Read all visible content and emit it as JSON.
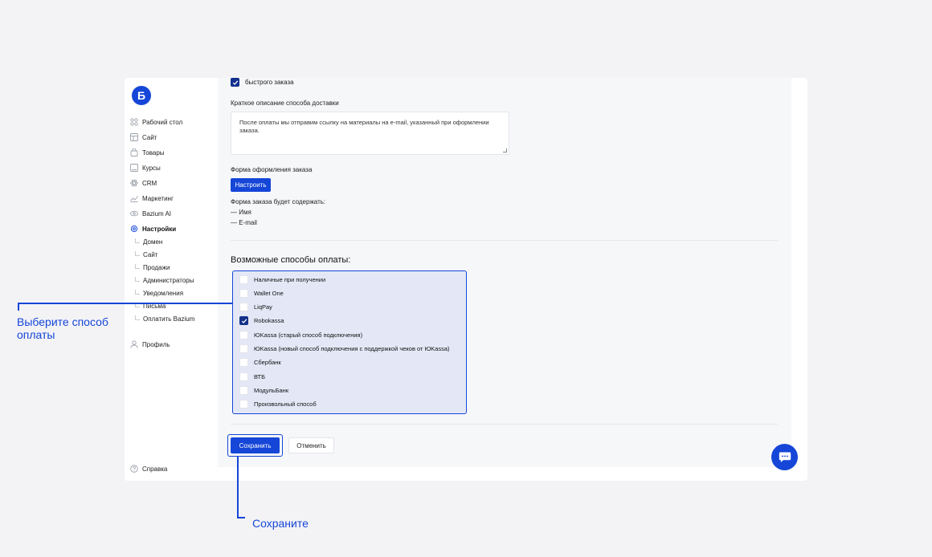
{
  "logo": {
    "letter": "Б"
  },
  "sidebar": {
    "items": [
      {
        "label": "Рабочий стол",
        "icon": "grid-icon"
      },
      {
        "label": "Сайт",
        "icon": "layout-icon"
      },
      {
        "label": "Товары",
        "icon": "bag-icon"
      },
      {
        "label": "Курсы",
        "icon": "book-icon"
      },
      {
        "label": "CRM",
        "icon": "atom-icon"
      },
      {
        "label": "Маркетинг",
        "icon": "chart-icon"
      },
      {
        "label": "Bazium AI",
        "icon": "ai-icon"
      },
      {
        "label": "Настройки",
        "icon": "gear-icon"
      }
    ],
    "sub_items": [
      "Домен",
      "Сайт",
      "Продажи",
      "Администраторы",
      "Уведомления",
      "Письма",
      "Оплатить Bazium"
    ],
    "profile": "Профиль",
    "help": "Справка"
  },
  "form": {
    "quick_order_label": "быстрого заказа",
    "quick_order_checked": true,
    "description_label": "Краткое описание способа доставки",
    "description_value": "После оплаты мы отправим ссылку на материалы на e-mail, указанный при оформлении заказа.",
    "order_form_label": "Форма оформления заказа",
    "configure_button": "Настроить",
    "order_form_contents_title": "Форма заказа будет содержать:",
    "order_form_fields": [
      "— Имя",
      "— E-mail"
    ],
    "payment_title": "Возможные способы оплаты:",
    "payment_methods": [
      {
        "label": "Наличные при получении",
        "checked": false
      },
      {
        "label": "Wallet One",
        "checked": false
      },
      {
        "label": "LiqPay",
        "checked": false
      },
      {
        "label": "Robokassa",
        "checked": true
      },
      {
        "label": "ЮKassa (старый способ подключения)",
        "checked": false
      },
      {
        "label": "ЮKassa (новый способ подключения с поддержкой чеков от ЮKassa)",
        "checked": false
      },
      {
        "label": "Сбербанк",
        "checked": false
      },
      {
        "label": "ВТБ",
        "checked": false
      },
      {
        "label": "МодульБанк",
        "checked": false
      },
      {
        "label": "Произвольный способ",
        "checked": false
      }
    ],
    "save_button": "Сохранить",
    "cancel_button": "Отменить"
  },
  "annotations": {
    "payment_hint": "Выберите способ оплаты",
    "save_hint": "Сохраните"
  },
  "colors": {
    "accent": "#1546d8",
    "checkbox_checked": "#12308c",
    "highlight_bg": "#e4e8f6",
    "page_bg": "#f3f3f6"
  }
}
